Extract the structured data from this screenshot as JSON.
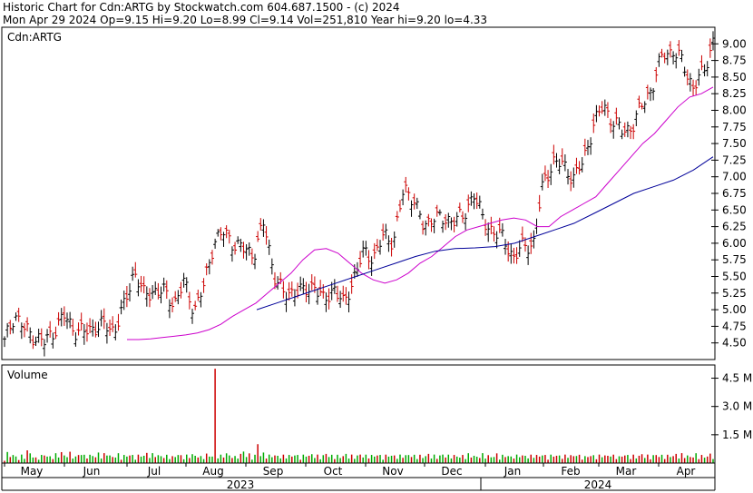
{
  "header": {
    "line1": "Historic Chart for Cdn:ARTG by Stockwatch.com 604.687.1500 - (c) 2024",
    "line2": "Mon Apr 29 2024  Op=9.15  Hi=9.20  Lo=8.99  Cl=9.14  Vol=251,810  Year hi=9.20  lo=4.33"
  },
  "colors": {
    "up_bar": "#000000",
    "down_bar": "#cc0000",
    "ma_short": "#cc00cc",
    "ma_long": "#000099",
    "vol_up": "#00aa00",
    "vol_down": "#cc0000",
    "frame": "#000000"
  },
  "chart_data": [
    {
      "type": "line",
      "subtype": "ohlc",
      "title": "Cdn:ARTG",
      "ylim": [
        4.25,
        9.25
      ],
      "yticks": [
        "4.50",
        "4.75",
        "5.00",
        "5.25",
        "5.50",
        "5.75",
        "6.00",
        "6.25",
        "6.50",
        "6.75",
        "7.00",
        "7.25",
        "7.50",
        "7.75",
        "8.00",
        "8.25",
        "8.50",
        "8.75",
        "9.00"
      ],
      "months": [
        "May",
        "Jun",
        "Jul",
        "Aug",
        "Sep",
        "Oct",
        "Nov",
        "Dec",
        "Jan",
        "Feb",
        "Mar",
        "Apr"
      ],
      "years": [
        "2023",
        "2024"
      ],
      "series": [
        {
          "values": [
            4.5,
            4.95,
            4.7,
            4.6,
            4.5,
            4.7,
            4.9,
            4.7,
            4.65,
            4.75,
            4.75,
            4.7,
            5.05,
            5.6,
            5.2,
            5.3,
            5.25,
            5.1,
            5.4,
            5.0,
            5.35,
            6.05,
            6.15,
            6.0,
            5.9,
            5.85,
            6.3,
            5.55,
            5.2,
            5.3,
            5.25,
            5.4,
            5.1,
            5.35,
            5.05,
            5.5,
            5.85,
            5.8,
            6.1,
            6.05,
            6.8,
            6.7,
            6.2,
            6.45,
            6.3,
            6.4,
            6.35,
            6.8,
            6.3,
            6.2,
            6.05,
            5.8,
            5.95,
            6.0,
            6.9,
            7.25,
            7.15,
            7.0,
            7.2,
            7.8,
            8.05,
            7.85,
            7.65,
            7.8,
            8.1,
            8.4,
            8.85,
            8.9,
            8.7,
            8.35,
            8.55,
            9.05
          ]
        },
        {
          "values": [
            4.55,
            4.55,
            4.56,
            4.58,
            4.6,
            4.62,
            4.65,
            4.7,
            4.78,
            4.9,
            5.0,
            5.1,
            5.25,
            5.4,
            5.55,
            5.75,
            5.9,
            5.92,
            5.85,
            5.7,
            5.55,
            5.45,
            5.4,
            5.45,
            5.55,
            5.7,
            5.8,
            5.95,
            6.1,
            6.2,
            6.25,
            6.3,
            6.35,
            6.38,
            6.35,
            6.25,
            6.25,
            6.4,
            6.5,
            6.6,
            6.7,
            6.9,
            7.1,
            7.3,
            7.5,
            7.65,
            7.85,
            8.05,
            8.2,
            8.25,
            8.35
          ]
        },
        {
          "values": [
            5.0,
            5.1,
            5.2,
            5.3,
            5.4,
            5.5,
            5.6,
            5.7,
            5.8,
            5.88,
            5.92,
            5.93,
            5.95,
            6.0,
            6.1,
            6.2,
            6.3,
            6.45,
            6.6,
            6.75,
            6.85,
            6.95,
            7.1,
            7.3
          ]
        }
      ]
    },
    {
      "type": "bar",
      "title": "Volume",
      "ylim": [
        0,
        5.2
      ],
      "yticks": [
        "1.5 M",
        "3.0 M",
        "4.5 M"
      ],
      "series": [
        {
          "values": [
            0.2,
            0.4,
            0.3,
            0.35,
            0.25,
            0.2,
            0.3,
            0.25,
            0.5,
            0.4,
            0.3,
            0.2,
            0.25,
            0.3,
            0.35,
            0.4,
            0.3,
            0.25,
            0.3,
            0.35,
            0.3,
            0.45,
            0.3,
            0.35,
            0.4,
            0.3,
            0.25,
            0.35,
            0.4,
            0.3,
            0.4,
            0.3,
            0.3,
            0.35,
            0.25,
            0.4,
            0.3,
            0.35,
            0.45,
            0.3,
            0.25,
            0.3,
            0.35,
            0.25,
            0.3,
            0.3,
            0.5,
            0.35,
            0.3,
            0.25,
            0.3,
            0.35,
            0.3,
            0.4,
            0.3,
            0.35,
            0.4,
            0.3,
            0.3,
            0.25,
            0.3,
            0.35,
            0.3,
            0.25,
            0.3,
            0.35,
            0.3,
            0.25,
            0.3,
            0.3,
            0.35,
            0.3,
            0.3,
            0.25,
            0.3,
            0.35,
            0.3,
            0.3,
            0.25,
            0.3,
            0.35,
            0.3,
            0.3,
            0.4,
            0.3,
            0.3,
            0.25,
            0.3,
            0.35,
            0.5,
            0.3,
            0.35,
            0.3,
            0.25,
            0.3,
            0.35,
            0.3,
            0.4,
            0.3,
            0.3,
            0.35,
            0.3,
            0.3,
            0.25,
            0.3,
            0.35,
            0.3,
            0.3,
            0.35,
            0.3,
            0.3,
            0.25,
            0.3,
            0.35,
            0.3,
            0.35,
            0.3,
            0.3,
            0.25,
            0.3,
            0.4,
            0.3,
            0.3,
            0.35,
            0.3,
            0.3,
            0.25,
            0.3,
            0.35,
            0.3,
            0.3,
            0.25,
            0.3,
            0.35,
            0.3,
            0.3,
            0.35,
            0.3,
            0.3,
            0.35,
            0.3,
            0.3,
            0.25,
            0.3,
            0.35,
            0.3,
            0.3,
            0.25,
            0.3,
            0.35,
            0.3,
            0.35,
            0.3,
            0.3,
            0.35,
            0.3,
            0.3,
            0.25,
            0.3,
            0.35,
            0.3,
            0.3,
            0.25,
            0.3,
            0.35,
            0.3,
            0.3,
            0.35,
            0.3,
            0.3,
            0.25,
            0.3,
            0.35,
            0.3,
            0.35,
            0.3,
            0.3,
            0.25,
            0.3,
            0.35,
            0.3,
            0.3,
            0.25,
            0.3,
            0.35,
            0.3,
            0.3,
            0.35,
            0.3,
            0.3,
            0.25,
            0.3,
            0.3,
            0.35,
            0.3,
            0.3,
            0.25,
            0.3,
            0.4,
            0.3,
            0.3,
            0.35,
            0.3,
            0.3,
            0.25,
            0.3,
            0.35,
            0.3,
            0.3,
            0.25,
            0.3,
            0.35,
            0.3,
            0.3,
            0.35,
            0.3,
            0.3,
            0.25,
            0.3,
            0.35,
            0.3,
            0.3,
            0.25,
            0.3,
            0.35,
            0.3,
            0.3,
            0.35,
            0.3,
            0.3,
            0.25,
            0.3,
            0.35,
            0.3,
            0.35,
            0.3,
            0.3,
            0.25,
            0.3,
            0.35,
            0.3,
            0.3,
            0.25,
            0.3,
            0.35,
            0.3,
            0.3,
            0.35,
            0.3,
            0.3,
            0.25,
            0.3,
            0.35,
            0.3,
            0.35,
            0.3,
            0.3,
            0.25,
            0.3,
            0.35,
            0.3,
            0.3,
            0.25,
            0.3,
            0.35,
            0.3,
            0.3
          ]
        }
      ]
    }
  ]
}
